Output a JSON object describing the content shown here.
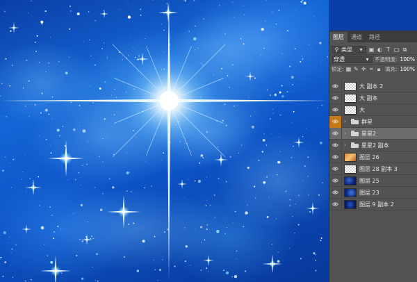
{
  "panel": {
    "tabs": [
      {
        "label": "图层",
        "active": true
      },
      {
        "label": "通道",
        "active": false
      },
      {
        "label": "路径",
        "active": false
      }
    ],
    "filter": {
      "label": "类型",
      "icons": [
        "image-filter-icon",
        "adjustment-filter-icon",
        "type-filter-icon",
        "shape-filter-icon",
        "smart-object-filter-icon"
      ]
    },
    "blend_mode": "穿透",
    "opacity": {
      "label": "不透明度:",
      "value": "100%"
    },
    "lock": {
      "label": "锁定:",
      "icons": [
        "lock-transparent-icon",
        "lock-paint-icon",
        "lock-move-icon",
        "lock-artboard-icon",
        "lock-all-icon"
      ]
    },
    "fill": {
      "label": "填充:",
      "value": "100%"
    },
    "layers": [
      {
        "name": "大 副本 2",
        "kind": "layer",
        "thumb": "checker",
        "selected": false,
        "highlight": false
      },
      {
        "name": "大 副本",
        "kind": "layer",
        "thumb": "checker",
        "selected": false,
        "highlight": false
      },
      {
        "name": "大",
        "kind": "layer",
        "thumb": "checker",
        "selected": false,
        "highlight": false
      },
      {
        "name": "群星",
        "kind": "group",
        "thumb": "",
        "selected": false,
        "highlight": true
      },
      {
        "name": "星星2",
        "kind": "group",
        "thumb": "",
        "selected": true,
        "highlight": false
      },
      {
        "name": "星星2 副本",
        "kind": "group",
        "thumb": "",
        "selected": false,
        "highlight": false
      },
      {
        "name": "图层 26",
        "kind": "layer",
        "thumb": "orange",
        "selected": false,
        "highlight": false
      },
      {
        "name": "图层 28 副本 3",
        "kind": "layer",
        "thumb": "checker",
        "selected": false,
        "highlight": false
      },
      {
        "name": "图层 25",
        "kind": "layer",
        "thumb": "navy",
        "selected": false,
        "highlight": false
      },
      {
        "name": "图层 23",
        "kind": "layer",
        "thumb": "navy2",
        "selected": false,
        "highlight": false
      },
      {
        "name": "图层 9 副本 2",
        "kind": "layer",
        "thumb": "navy3",
        "selected": false,
        "highlight": false
      }
    ]
  },
  "colors": {
    "panel_bg": "#535353",
    "selected_row": "#6b6b6b",
    "eye_highlight": "#c67a17",
    "canvas_blue": "#1466d6"
  }
}
